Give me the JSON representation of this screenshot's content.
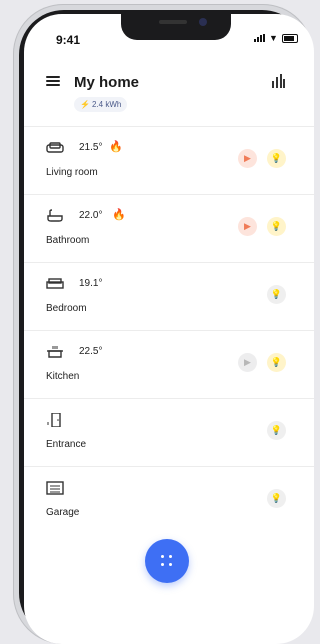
{
  "status_bar": {
    "time": "9:41"
  },
  "header": {
    "menu_icon": "hamburger-menu-icon",
    "title": "My home",
    "energy": "2.4 kWh",
    "stats_icon": "bar-chart-icon"
  },
  "rooms": [
    {
      "name": "Living room",
      "temperature": "21.5°",
      "heating": true,
      "icon": "sofa-icon",
      "media": "active",
      "light": "on"
    },
    {
      "name": "Bathroom",
      "temperature": "22.0°",
      "heating": true,
      "icon": "bathtub-icon",
      "media": "active",
      "light": "on"
    },
    {
      "name": "Bedroom",
      "temperature": "19.1°",
      "heating": false,
      "icon": "bed-icon",
      "media": null,
      "light": "off"
    },
    {
      "name": "Kitchen",
      "temperature": "22.5°",
      "heating": false,
      "icon": "pot-icon",
      "media": "inactive",
      "light": "on"
    },
    {
      "name": "Entrance",
      "temperature": "",
      "heating": false,
      "icon": "door-icon",
      "media": null,
      "light": "off"
    },
    {
      "name": "Garage",
      "temperature": "",
      "heating": false,
      "icon": "garage-icon",
      "media": null,
      "light": "off"
    }
  ],
  "fab": {
    "icon": "apps-grid-icon"
  }
}
